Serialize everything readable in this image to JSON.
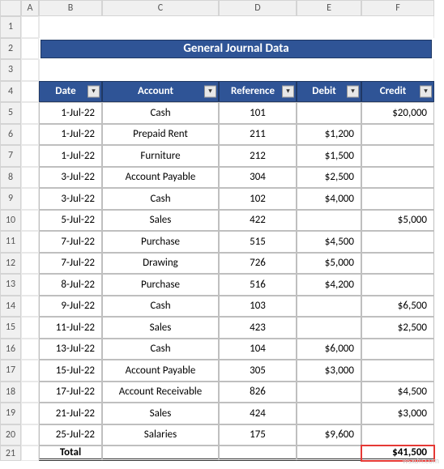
{
  "columns": [
    "A",
    "B",
    "C",
    "D",
    "E",
    "F"
  ],
  "rowNumbers": [
    1,
    2,
    3,
    4,
    5,
    6,
    7,
    8,
    9,
    10,
    11,
    12,
    13,
    14,
    15,
    16,
    17,
    18,
    19,
    20,
    21
  ],
  "title": "General Journal Data",
  "headers": {
    "date": "Date",
    "account": "Account",
    "reference": "Reference",
    "debit": "Debit",
    "credit": "Credit"
  },
  "rows": [
    {
      "date": "1-Jul-22",
      "account": "Cash",
      "reference": "101",
      "debit": "",
      "credit": "$20,000"
    },
    {
      "date": "1-Jul-22",
      "account": "Prepaid Rent",
      "reference": "211",
      "debit": "$1,200",
      "credit": ""
    },
    {
      "date": "1-Jul-22",
      "account": "Furniture",
      "reference": "212",
      "debit": "$1,500",
      "credit": ""
    },
    {
      "date": "3-Jul-22",
      "account": "Account Payable",
      "reference": "304",
      "debit": "$2,500",
      "credit": ""
    },
    {
      "date": "3-Jul-22",
      "account": "Cash",
      "reference": "102",
      "debit": "$4,000",
      "credit": ""
    },
    {
      "date": "5-Jul-22",
      "account": "Sales",
      "reference": "422",
      "debit": "",
      "credit": "$5,000"
    },
    {
      "date": "7-Jul-22",
      "account": "Purchase",
      "reference": "515",
      "debit": "$4,500",
      "credit": ""
    },
    {
      "date": "7-Jul-22",
      "account": "Drawing",
      "reference": "726",
      "debit": "$5,000",
      "credit": ""
    },
    {
      "date": "8-Jul-22",
      "account": "Purchase",
      "reference": "516",
      "debit": "$4,200",
      "credit": ""
    },
    {
      "date": "9-Jul-22",
      "account": "Cash",
      "reference": "103",
      "debit": "",
      "credit": "$6,500"
    },
    {
      "date": "11-Jul-22",
      "account": "Sales",
      "reference": "423",
      "debit": "",
      "credit": "$2,500"
    },
    {
      "date": "13-Jul-22",
      "account": "Cash",
      "reference": "104",
      "debit": "$6,000",
      "credit": ""
    },
    {
      "date": "15-Jul-22",
      "account": "Account Payable",
      "reference": "305",
      "debit": "$3,000",
      "credit": ""
    },
    {
      "date": "17-Jul-22",
      "account": "Account Receivable",
      "reference": "826",
      "debit": "",
      "credit": "$4,500"
    },
    {
      "date": "21-Jul-22",
      "account": "Sales",
      "reference": "424",
      "debit": "",
      "credit": "$3,000"
    },
    {
      "date": "25-Jul-22",
      "account": "Salaries",
      "reference": "175",
      "debit": "$9,600",
      "credit": ""
    }
  ],
  "total": {
    "label": "Total",
    "credit": "$41,500"
  },
  "watermark": "wsxdn.com"
}
